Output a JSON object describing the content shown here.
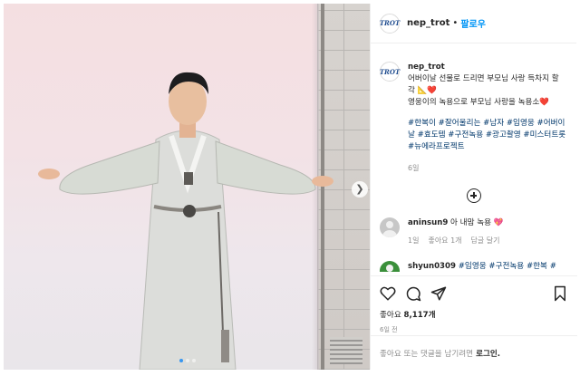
{
  "post": {
    "username": "nep_trot",
    "separator": "•",
    "follow_label": "팔로우",
    "avatar_text": "TROT",
    "caption_line1": "어버이날 선물로 드리면 부모님 사랑 득차지 할 각 📐❤️",
    "caption_line2": "영웅이의 녹용으로 부모님 사랑을 녹용소❤️",
    "hashtags": "#한복이 #잘어울리는 #남자 #임영웅 #어버이날 #효도템 #구전녹용 #광고촬영 #미스터트롯 #뉴에라프로젝트",
    "caption_time": "6일",
    "carousel_dots": 3,
    "active_dot": 0
  },
  "comments": [
    {
      "username": "aninsun9",
      "text": "아 내맘 녹용 💖",
      "time": "1일",
      "likes": "좋아요 1개",
      "reply": "답글 달기"
    },
    {
      "username": "shyun0309",
      "text": "#임영웅 #구전녹용 #한복 #"
    }
  ],
  "actions": {
    "likes_label": "좋아요",
    "likes_count": "8,117개",
    "time_ago": "6일 전"
  },
  "login_bar": {
    "prompt": "좋아요 또는 댓글을 남기려면",
    "login_link": "로그인."
  },
  "icons": [
    "heart-icon",
    "comment-icon",
    "share-icon",
    "bookmark-icon",
    "add-circle-icon",
    "chevron-right-icon"
  ],
  "colors": {
    "link": "#0095f6",
    "hashtag": "#00376b",
    "meta": "#8e8e8e",
    "active_dot": "#3897f0"
  }
}
